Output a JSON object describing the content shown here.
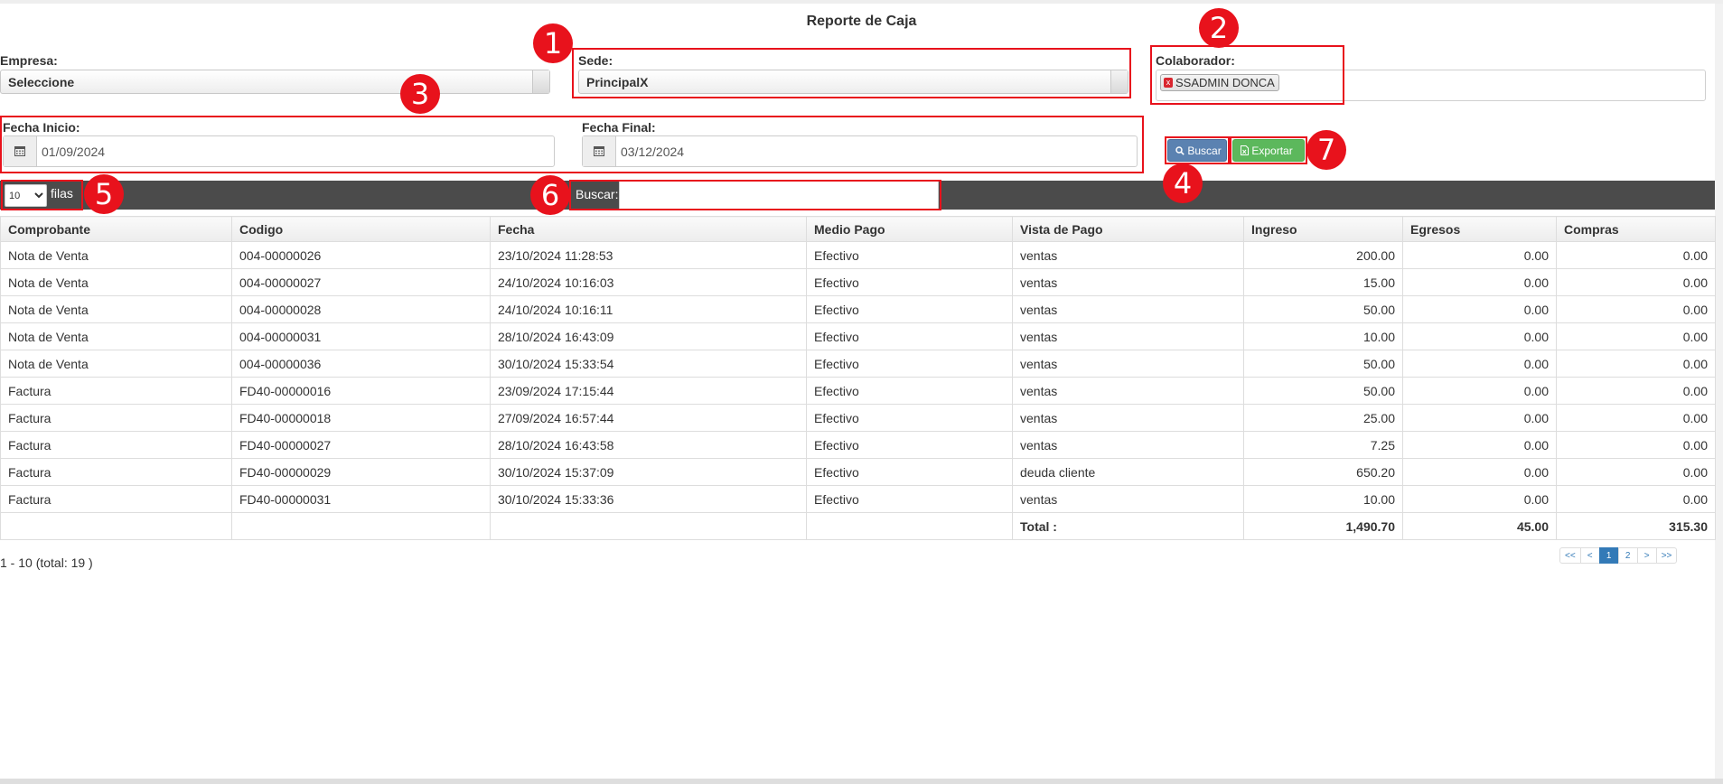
{
  "title": "Reporte de Caja",
  "empresa": {
    "label": "Empresa:",
    "value": "Seleccione"
  },
  "sede": {
    "label": "Sede:",
    "value": "PrincipalX"
  },
  "colaborador": {
    "label": "Colaborador:",
    "chip": "SSADMIN DONCA",
    "chip_remove": "x"
  },
  "fecha_inicio": {
    "label": "Fecha Inicio:",
    "value": "01/09/2024"
  },
  "fecha_final": {
    "label": "Fecha Final:",
    "value": "03/12/2024"
  },
  "buttons": {
    "buscar": "Buscar",
    "exportar": "Exportar"
  },
  "rows_per_page": {
    "selected": "10",
    "label": "filas"
  },
  "search": {
    "label": "Buscar:",
    "value": ""
  },
  "table": {
    "headers": [
      "Comprobante",
      "Codigo",
      "Fecha",
      "Medio Pago",
      "Vista de Pago",
      "Ingreso",
      "Egresos",
      "Compras"
    ],
    "rows": [
      [
        "Nota de Venta",
        "004-00000026",
        "23/10/2024 11:28:53",
        "Efectivo",
        "ventas",
        "200.00",
        "0.00",
        "0.00"
      ],
      [
        "Nota de Venta",
        "004-00000027",
        "24/10/2024 10:16:03",
        "Efectivo",
        "ventas",
        "15.00",
        "0.00",
        "0.00"
      ],
      [
        "Nota de Venta",
        "004-00000028",
        "24/10/2024 10:16:11",
        "Efectivo",
        "ventas",
        "50.00",
        "0.00",
        "0.00"
      ],
      [
        "Nota de Venta",
        "004-00000031",
        "28/10/2024 16:43:09",
        "Efectivo",
        "ventas",
        "10.00",
        "0.00",
        "0.00"
      ],
      [
        "Nota de Venta",
        "004-00000036",
        "30/10/2024 15:33:54",
        "Efectivo",
        "ventas",
        "50.00",
        "0.00",
        "0.00"
      ],
      [
        "Factura",
        "FD40-00000016",
        "23/09/2024 17:15:44",
        "Efectivo",
        "ventas",
        "50.00",
        "0.00",
        "0.00"
      ],
      [
        "Factura",
        "FD40-00000018",
        "27/09/2024 16:57:44",
        "Efectivo",
        "ventas",
        "25.00",
        "0.00",
        "0.00"
      ],
      [
        "Factura",
        "FD40-00000027",
        "28/10/2024 16:43:58",
        "Efectivo",
        "ventas",
        "7.25",
        "0.00",
        "0.00"
      ],
      [
        "Factura",
        "FD40-00000029",
        "30/10/2024 15:37:09",
        "Efectivo",
        "deuda cliente",
        "650.20",
        "0.00",
        "0.00"
      ],
      [
        "Factura",
        "FD40-00000031",
        "30/10/2024 15:33:36",
        "Efectivo",
        "ventas",
        "10.00",
        "0.00",
        "0.00"
      ]
    ],
    "totals": {
      "label": "Total :",
      "ingreso": "1,490.70",
      "egresos": "45.00",
      "compras": "315.30"
    }
  },
  "pagination": {
    "info": "1 - 10 (total: 19 )",
    "first": "<<",
    "prev": "<",
    "page1": "1",
    "page2": "2",
    "next": ">",
    "last": ">>"
  },
  "annotations": [
    "1",
    "2",
    "3",
    "4",
    "5",
    "6",
    "7"
  ],
  "icons": {
    "calendar": "calendar-icon",
    "search": "search-icon",
    "excel": "file-excel-icon"
  },
  "colors": {
    "highlight": "#e8121c",
    "buscar": "#5b82b1",
    "exportar": "#5cb85c",
    "toolbar": "#4b4b4b",
    "page_active": "#337ab7"
  }
}
